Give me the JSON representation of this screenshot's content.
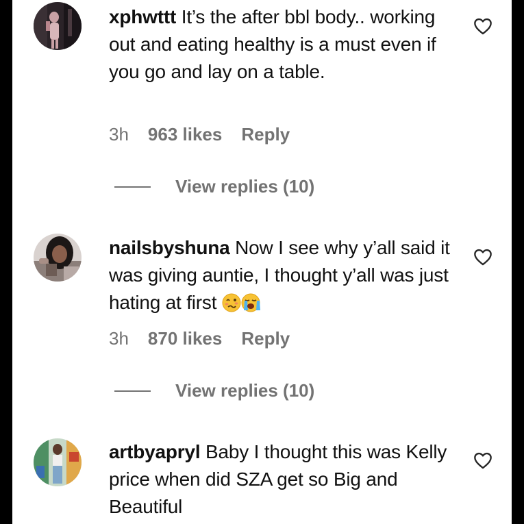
{
  "comments": [
    {
      "username": "xphwttt",
      "text": "It’s the after bbl body.. working out and eating healthy is a must even if you go and lay on a table.",
      "time": "3h",
      "likes": "963 likes",
      "reply_label": "Reply",
      "view_replies": "View replies (10)",
      "avatar_icon": "avatar-photo"
    },
    {
      "username": "nailsbyshuna",
      "text": "Now I see why y’all said it was giving auntie, I thought y’all was just hating at first",
      "emojis": [
        "woozy-face-emoji",
        "loudly-crying-face-emoji"
      ],
      "time": "3h",
      "likes": "870 likes",
      "reply_label": "Reply",
      "view_replies": "View replies (10)",
      "avatar_icon": "avatar-photo"
    },
    {
      "username": "artbyapryl",
      "text": "Baby I thought this was Kelly price when did SZA get so Big and Beautiful",
      "avatar_icon": "avatar-photo"
    }
  ],
  "icons": {
    "like": "heart-outline-icon"
  },
  "colors": {
    "background": "#ffffff",
    "frame": "#000000",
    "muted": "#737373",
    "text": "#111111"
  }
}
